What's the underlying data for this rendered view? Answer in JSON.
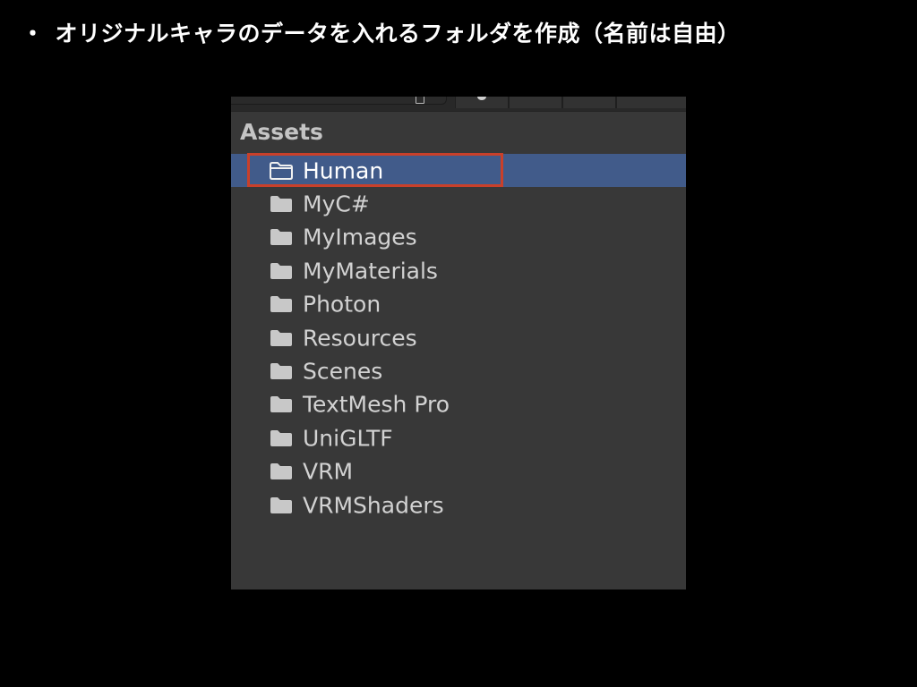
{
  "caption": {
    "bullet": "・",
    "text": "オリジナルキャラのデータを入れるフォルダを作成（名前は自由）"
  },
  "panel": {
    "title": "Assets",
    "selected_index": 0,
    "items": [
      {
        "label": "Human",
        "icon": "folder-outline-icon"
      },
      {
        "label": "MyC#",
        "icon": "folder-icon"
      },
      {
        "label": "MyImages",
        "icon": "folder-icon"
      },
      {
        "label": "MyMaterials",
        "icon": "folder-icon"
      },
      {
        "label": "Photon",
        "icon": "folder-icon"
      },
      {
        "label": "Resources",
        "icon": "folder-icon"
      },
      {
        "label": "Scenes",
        "icon": "folder-icon"
      },
      {
        "label": "TextMesh Pro",
        "icon": "folder-icon"
      },
      {
        "label": "UniGLTF",
        "icon": "folder-icon"
      },
      {
        "label": "VRM",
        "icon": "folder-icon"
      },
      {
        "label": "VRMShaders",
        "icon": "folder-icon"
      }
    ]
  },
  "colors": {
    "background": "#000000",
    "panel": "#383838",
    "selection": "#415b8a",
    "highlight_border": "#c9402a",
    "text": "#d2d2d2"
  }
}
